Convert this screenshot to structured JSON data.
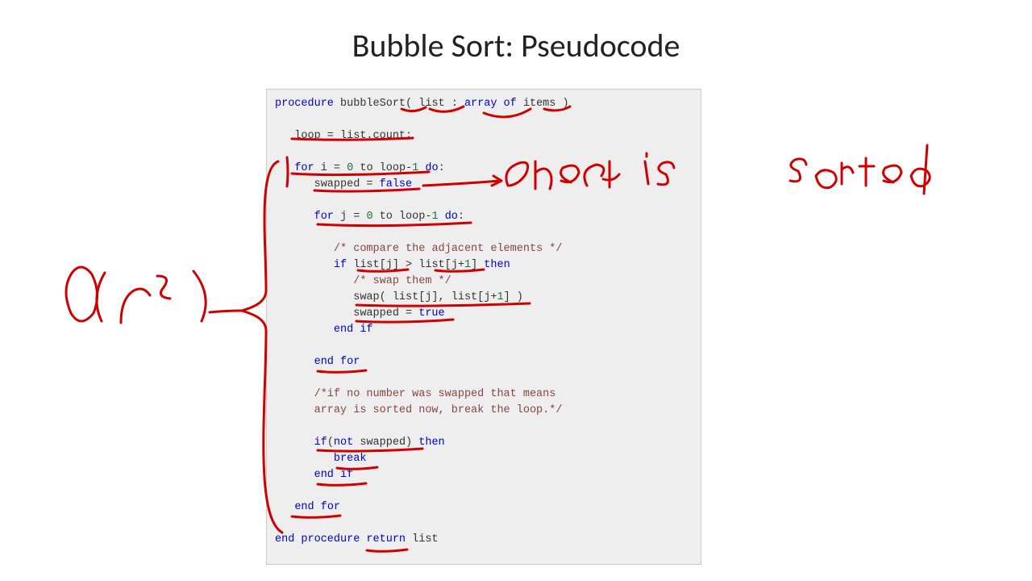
{
  "title": "Bubble Sort: Pseudocode",
  "code": {
    "l1a": "procedure",
    "l1b": " bubbleSort( list : ",
    "l1c": "array of",
    "l1d": " items )",
    "l2a": "   loop = list.count;",
    "l3a": "   ",
    "l3b": "for",
    "l3c": " i = ",
    "l3d": "0",
    "l3e": " to loop-",
    "l3f": "1",
    "l3g": " ",
    "l3h": "do",
    "l3i": ":",
    "l4a": "      swapped = ",
    "l4b": "false",
    "l5a": "      ",
    "l5b": "for",
    "l5c": " j = ",
    "l5d": "0",
    "l5e": " to loop-",
    "l5f": "1",
    "l5g": " ",
    "l5h": "do",
    "l5i": ":",
    "l6a": "         ",
    "l6b": "/* compare the adjacent elements */",
    "l7a": "         ",
    "l7b": "if",
    "l7c": " list[j] > list[j+",
    "l7d": "1",
    "l7e": "] ",
    "l7f": "then",
    "l8a": "            ",
    "l8b": "/* swap them */",
    "l9a": "            swap( list[j], list[j+",
    "l9b": "1",
    "l9c": "] )",
    "l10a": "            swapped = ",
    "l10b": "true",
    "l11a": "         ",
    "l11b": "end if",
    "l12a": "      ",
    "l12b": "end for",
    "l13a": "      ",
    "l13b": "/*if no number was swapped that means",
    "l14a": "      array is sorted now, break the loop.*/",
    "l15a": "      ",
    "l15b": "if",
    "l15c": "(",
    "l15d": "not",
    "l15e": " swapped) ",
    "l15f": "then",
    "l16a": "         ",
    "l16b": "break",
    "l17a": "      ",
    "l17b": "end if",
    "l18a": "   ",
    "l18b": "end for",
    "l19a": "end procedure return",
    "l19b": " list"
  },
  "annotations": {
    "complexity": "O(n²)",
    "note1": "check is sorted"
  },
  "ink_color": "#d00000"
}
